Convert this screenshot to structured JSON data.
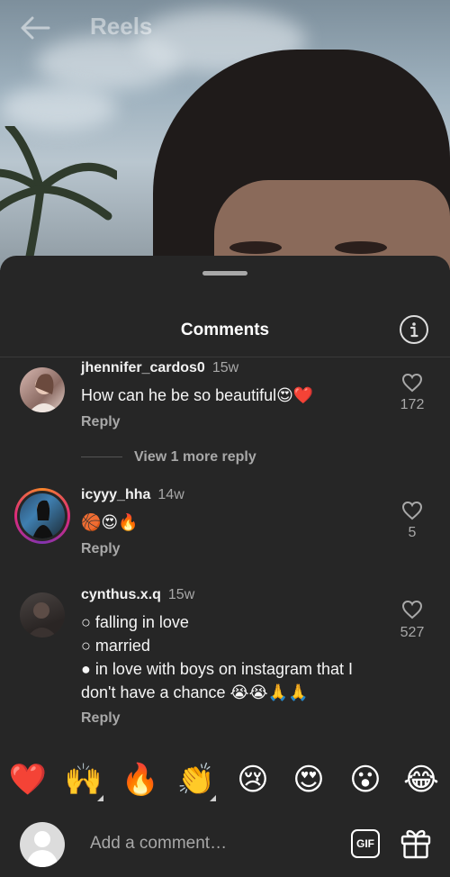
{
  "header": {
    "title": "Reels",
    "back_icon": "arrow-left-icon"
  },
  "sheet": {
    "title": "Comments",
    "info_icon": "info-icon"
  },
  "comments": [
    {
      "username": "jhennifer_cardos0",
      "time": "15w",
      "text": "How can he be so beautiful😍❤️",
      "reply": "Reply",
      "likes": "172",
      "view_more": "View 1 more reply"
    },
    {
      "username": "icyyy_hha",
      "time": "14w",
      "text": "🏀😍🔥",
      "reply": "Reply",
      "likes": "5",
      "has_story_ring": true
    },
    {
      "username": "cynthus.x.q",
      "time": "15w",
      "lines": [
        "○ falling in love",
        "○ married",
        "● in love with boys on instagram that I don't have a chance 😭😭🙏🙏"
      ],
      "reply": "Reply",
      "likes": "527"
    }
  ],
  "emoji_bar": [
    "❤️",
    "🙌",
    "🔥",
    "👏",
    "😢",
    "😍",
    "😮",
    "😂"
  ],
  "input": {
    "placeholder": "Add a comment…",
    "gif_label": "GIF",
    "gift_icon": "gift-icon"
  },
  "colors": {
    "background": "#262626",
    "secondary_text": "#a8a8a8",
    "primary_text": "#ffffff"
  }
}
